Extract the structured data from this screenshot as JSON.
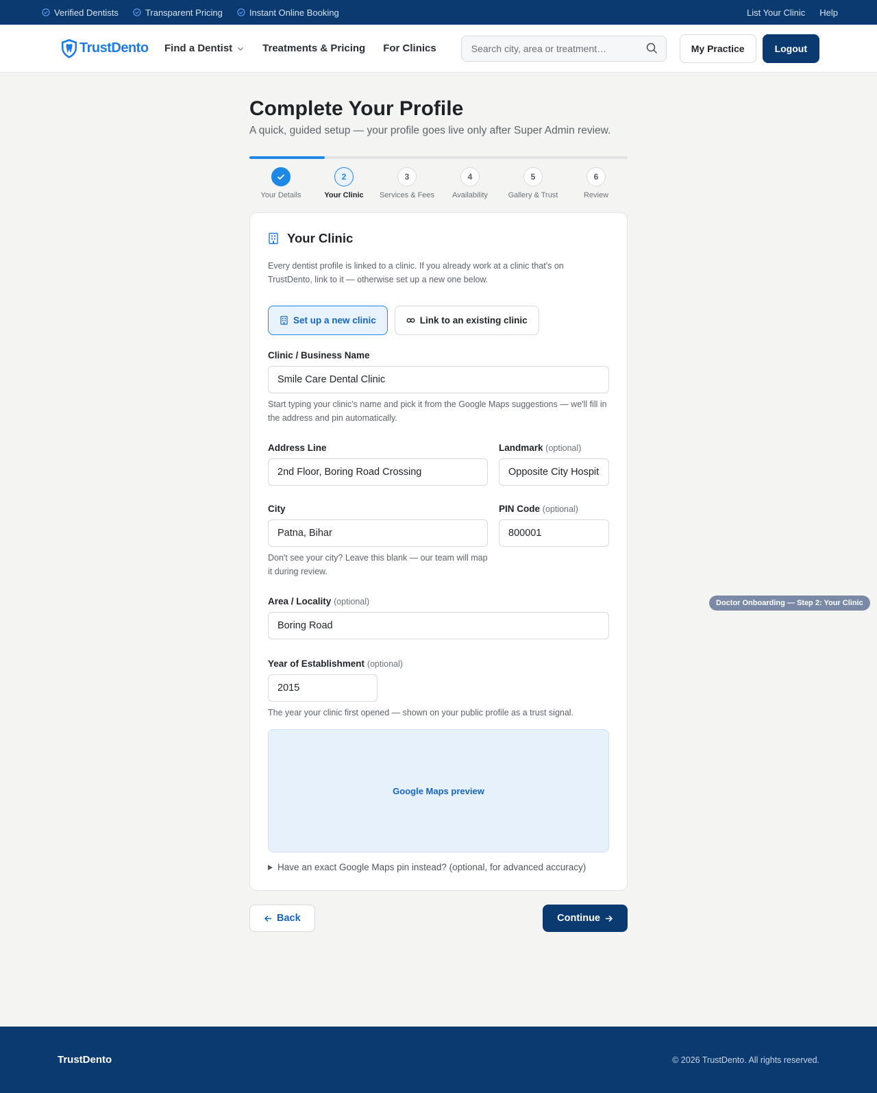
{
  "topbar": {
    "trust": [
      "Verified Dentists",
      "Transparent Pricing",
      "Instant Online Booking"
    ],
    "links": [
      "List Your Clinic",
      "Help"
    ]
  },
  "nav": {
    "brand": "TrustDento",
    "links": [
      "Find a Dentist",
      "Treatments & Pricing",
      "For Clinics"
    ],
    "search_placeholder": "Search city, area or treatment…",
    "my_practice": "My Practice",
    "logout": "Logout"
  },
  "page": {
    "title": "Complete Your Profile",
    "subtitle": "A quick, guided setup — your profile goes live only after Super Admin review."
  },
  "progress": {
    "current_step": 2,
    "total_steps": 6,
    "fill_fraction": 0.2
  },
  "steps": [
    {
      "num": "1",
      "label": "Your Details",
      "state": "done"
    },
    {
      "num": "2",
      "label": "Your Clinic",
      "state": "active"
    },
    {
      "num": "3",
      "label": "Services & Fees",
      "state": "todo"
    },
    {
      "num": "4",
      "label": "Availability",
      "state": "todo"
    },
    {
      "num": "5",
      "label": "Gallery & Trust",
      "state": "todo"
    },
    {
      "num": "6",
      "label": "Review",
      "state": "todo"
    }
  ],
  "card": {
    "title": "Your Clinic",
    "description": "Every dentist profile is linked to a clinic. If you already work at a clinic that's on TrustDento, link to it — otherwise set up a new one below.",
    "choice_new": "Set up a new clinic",
    "choice_link": "Link to an existing clinic"
  },
  "form": {
    "clinic_name": {
      "label": "Clinic / Business Name",
      "value": "Smile Care Dental Clinic",
      "help": "Start typing your clinic's name and pick it from the Google Maps suggestions — we'll fill in the address and pin automatically."
    },
    "address": {
      "label": "Address Line",
      "value": "2nd Floor, Boring Road Crossing"
    },
    "landmark": {
      "label": "Landmark",
      "optional": "(optional)",
      "value": "Opposite City Hospital"
    },
    "city": {
      "label": "City",
      "value": "Patna, Bihar",
      "help": "Don't see your city? Leave this blank — our team will map it during review."
    },
    "pin": {
      "label": "PIN Code",
      "optional": "(optional)",
      "value": "800001"
    },
    "area": {
      "label": "Area / Locality",
      "optional": "(optional)",
      "value": "Boring Road"
    },
    "year": {
      "label": "Year of Establishment",
      "optional": "(optional)",
      "value": "2015",
      "help": "The year your clinic first opened — shown on your public profile as a trust signal."
    },
    "map_preview": "Google Maps preview",
    "exact_pin": "Have an exact Google Maps pin instead? (optional, for advanced accuracy)"
  },
  "actions": {
    "back": "Back",
    "continue": "Continue"
  },
  "side_badge": "Doctor Onboarding — Step 2: Your Clinic",
  "footer": {
    "brand": "TrustDento",
    "copyright": "© 2026 TrustDento. All rights reserved."
  },
  "colors": {
    "primary_dark": "#0b3a70",
    "accent": "#1e88e5",
    "page_bg": "#f4f5f3"
  }
}
